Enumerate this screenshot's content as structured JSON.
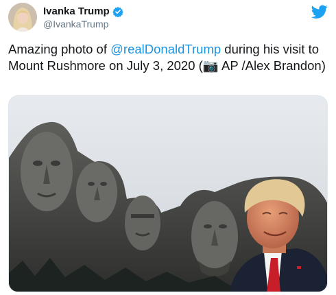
{
  "author": {
    "display_name": "Ivanka Trump",
    "handle": "@IvankaTrump",
    "verified": true,
    "avatar_icon": "avatar"
  },
  "brand": {
    "icon": "twitter-bird-icon",
    "color": "#1da1f2"
  },
  "tweet": {
    "text_before": "Amazing photo of ",
    "mention": "@realDonaldTrump",
    "text_after": " during his visit to Mount Rushmore on July 3, 2020 (",
    "camera_emoji": "📷",
    "credit": " AP /Alex Brandon)",
    "mention_color": "#1b95e0"
  },
  "media": {
    "icon": "photo-icon"
  }
}
